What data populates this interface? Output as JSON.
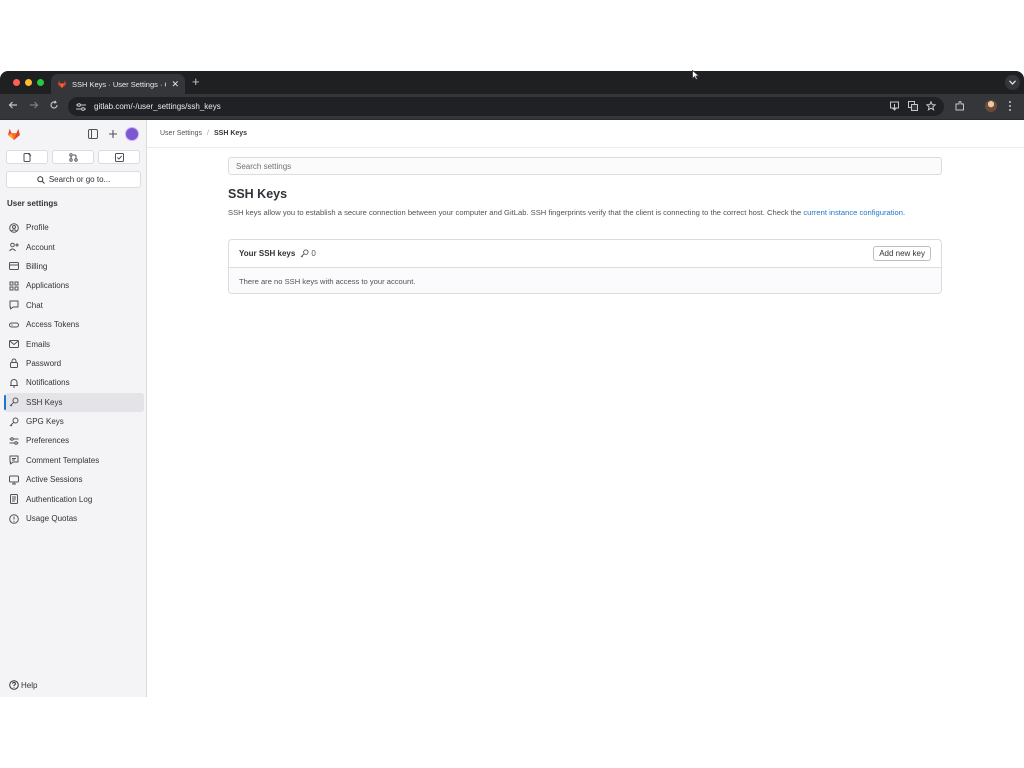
{
  "browser": {
    "tab_title": "SSH Keys · User Settings · GitLab",
    "tab_close": "✕",
    "new_tab": "+",
    "url": "gitlab.com/-/user_settings/ssh_keys"
  },
  "sidebar": {
    "search_label": "Search or go to...",
    "heading": "User settings",
    "items": [
      {
        "label": "Profile",
        "icon": "profile-icon"
      },
      {
        "label": "Account",
        "icon": "account-icon"
      },
      {
        "label": "Billing",
        "icon": "billing-icon"
      },
      {
        "label": "Applications",
        "icon": "applications-icon"
      },
      {
        "label": "Chat",
        "icon": "chat-icon"
      },
      {
        "label": "Access Tokens",
        "icon": "token-icon"
      },
      {
        "label": "Emails",
        "icon": "email-icon"
      },
      {
        "label": "Password",
        "icon": "lock-icon"
      },
      {
        "label": "Notifications",
        "icon": "bell-icon"
      },
      {
        "label": "SSH Keys",
        "icon": "key-icon",
        "active": true
      },
      {
        "label": "GPG Keys",
        "icon": "key-icon"
      },
      {
        "label": "Preferences",
        "icon": "preferences-icon"
      },
      {
        "label": "Comment Templates",
        "icon": "comment-icon"
      },
      {
        "label": "Active Sessions",
        "icon": "monitor-icon"
      },
      {
        "label": "Authentication Log",
        "icon": "log-icon"
      },
      {
        "label": "Usage Quotas",
        "icon": "quota-icon"
      }
    ],
    "help_label": "Help"
  },
  "breadcrumb": {
    "parent": "User Settings",
    "separator": "/",
    "current": "SSH Keys"
  },
  "main": {
    "search_placeholder": "Search settings",
    "title": "SSH Keys",
    "description": "SSH keys allow you to establish a secure connection between your computer and GitLab. SSH fingerprints verify that the client is connecting to the correct host. Check the ",
    "description_link": "current instance configuration",
    "description_end": ".",
    "card": {
      "title": "Your SSH keys",
      "count": "0",
      "add_button": "Add new key",
      "empty_text": "There are no SSH keys with access to your account."
    }
  },
  "colors": {
    "accent": "#1f75cb",
    "sidebar_bg": "#f4f4f6",
    "browser_chrome": "#35363a"
  }
}
